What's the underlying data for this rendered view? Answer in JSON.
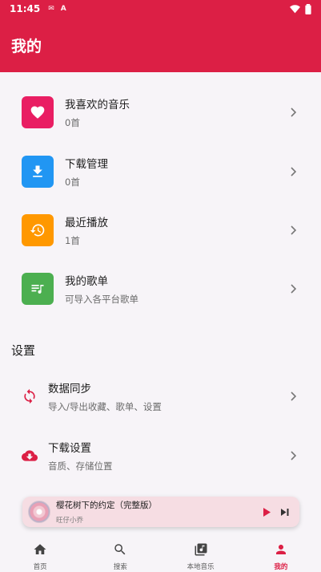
{
  "status_bar": {
    "time": "11:45"
  },
  "header": {
    "title": "我的"
  },
  "library": [
    {
      "title": "我喜欢的音乐",
      "subtitle": "0首",
      "icon": "heart-icon",
      "color": "#e91e63"
    },
    {
      "title": "下载管理",
      "subtitle": "0首",
      "icon": "download-icon",
      "color": "#2196f3"
    },
    {
      "title": "最近播放",
      "subtitle": "1首",
      "icon": "history-icon",
      "color": "#ff9800"
    },
    {
      "title": "我的歌单",
      "subtitle": "可导入各平台歌单",
      "icon": "playlist-icon",
      "color": "#4caf50"
    }
  ],
  "settings": {
    "title": "设置",
    "items": [
      {
        "title": "数据同步",
        "subtitle": "导入/导出收藏、歌单、设置",
        "icon": "sync-icon"
      },
      {
        "title": "下载设置",
        "subtitle": "音质、存储位置",
        "icon": "cloud-download-icon"
      }
    ]
  },
  "player": {
    "song": "樱花树下的约定（完整版）",
    "artist": "旺仔小乔"
  },
  "nav": [
    {
      "label": "首页",
      "icon": "home-icon"
    },
    {
      "label": "搜索",
      "icon": "search-icon"
    },
    {
      "label": "本地音乐",
      "icon": "library-music-icon"
    },
    {
      "label": "我的",
      "icon": "person-icon",
      "active": true
    }
  ],
  "colors": {
    "accent": "#dc1f45"
  }
}
